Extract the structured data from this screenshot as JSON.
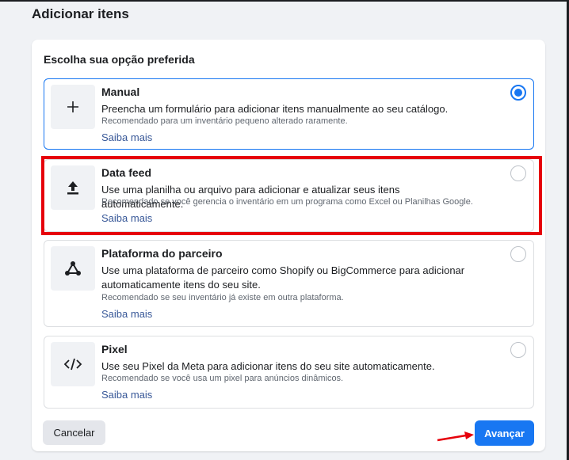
{
  "page": {
    "title": "Adicionar itens"
  },
  "panel": {
    "heading": "Escolha sua opção preferida"
  },
  "options": [
    {
      "title": "Manual",
      "description": "Preencha um formulário para adicionar itens manualmente ao seu catálogo.",
      "recommendation": "Recomendado para um inventário pequeno alterado raramente.",
      "link": "Saiba mais",
      "icon": "plus-icon",
      "selected": true
    },
    {
      "title": "Data feed",
      "description": "Use uma planilha ou arquivo para adicionar e atualizar seus itens automaticamente.",
      "recommendation": "Recomendado se você gerencia o inventário em um programa como Excel ou Planilhas Google.",
      "link": "Saiba mais",
      "icon": "upload-icon",
      "selected": false
    },
    {
      "title": "Plataforma do parceiro",
      "description": "Use uma plataforma de parceiro como Shopify ou BigCommerce para adicionar automaticamente itens do seu site.",
      "recommendation": "Recomendado se seu inventário já existe em outra plataforma.",
      "link": "Saiba mais",
      "icon": "network-icon",
      "selected": false
    },
    {
      "title": "Pixel",
      "description": "Use seu Pixel da Meta para adicionar itens do seu site automaticamente.",
      "recommendation": "Recomendado se você usa um pixel para anúncios dinâmicos.",
      "link": "Saiba mais",
      "icon": "code-icon",
      "selected": false
    }
  ],
  "footer": {
    "cancel_label": "Cancelar",
    "next_label": "Avançar"
  },
  "colors": {
    "accent": "#1877f2",
    "highlight": "#e6000b",
    "link": "#385898"
  }
}
